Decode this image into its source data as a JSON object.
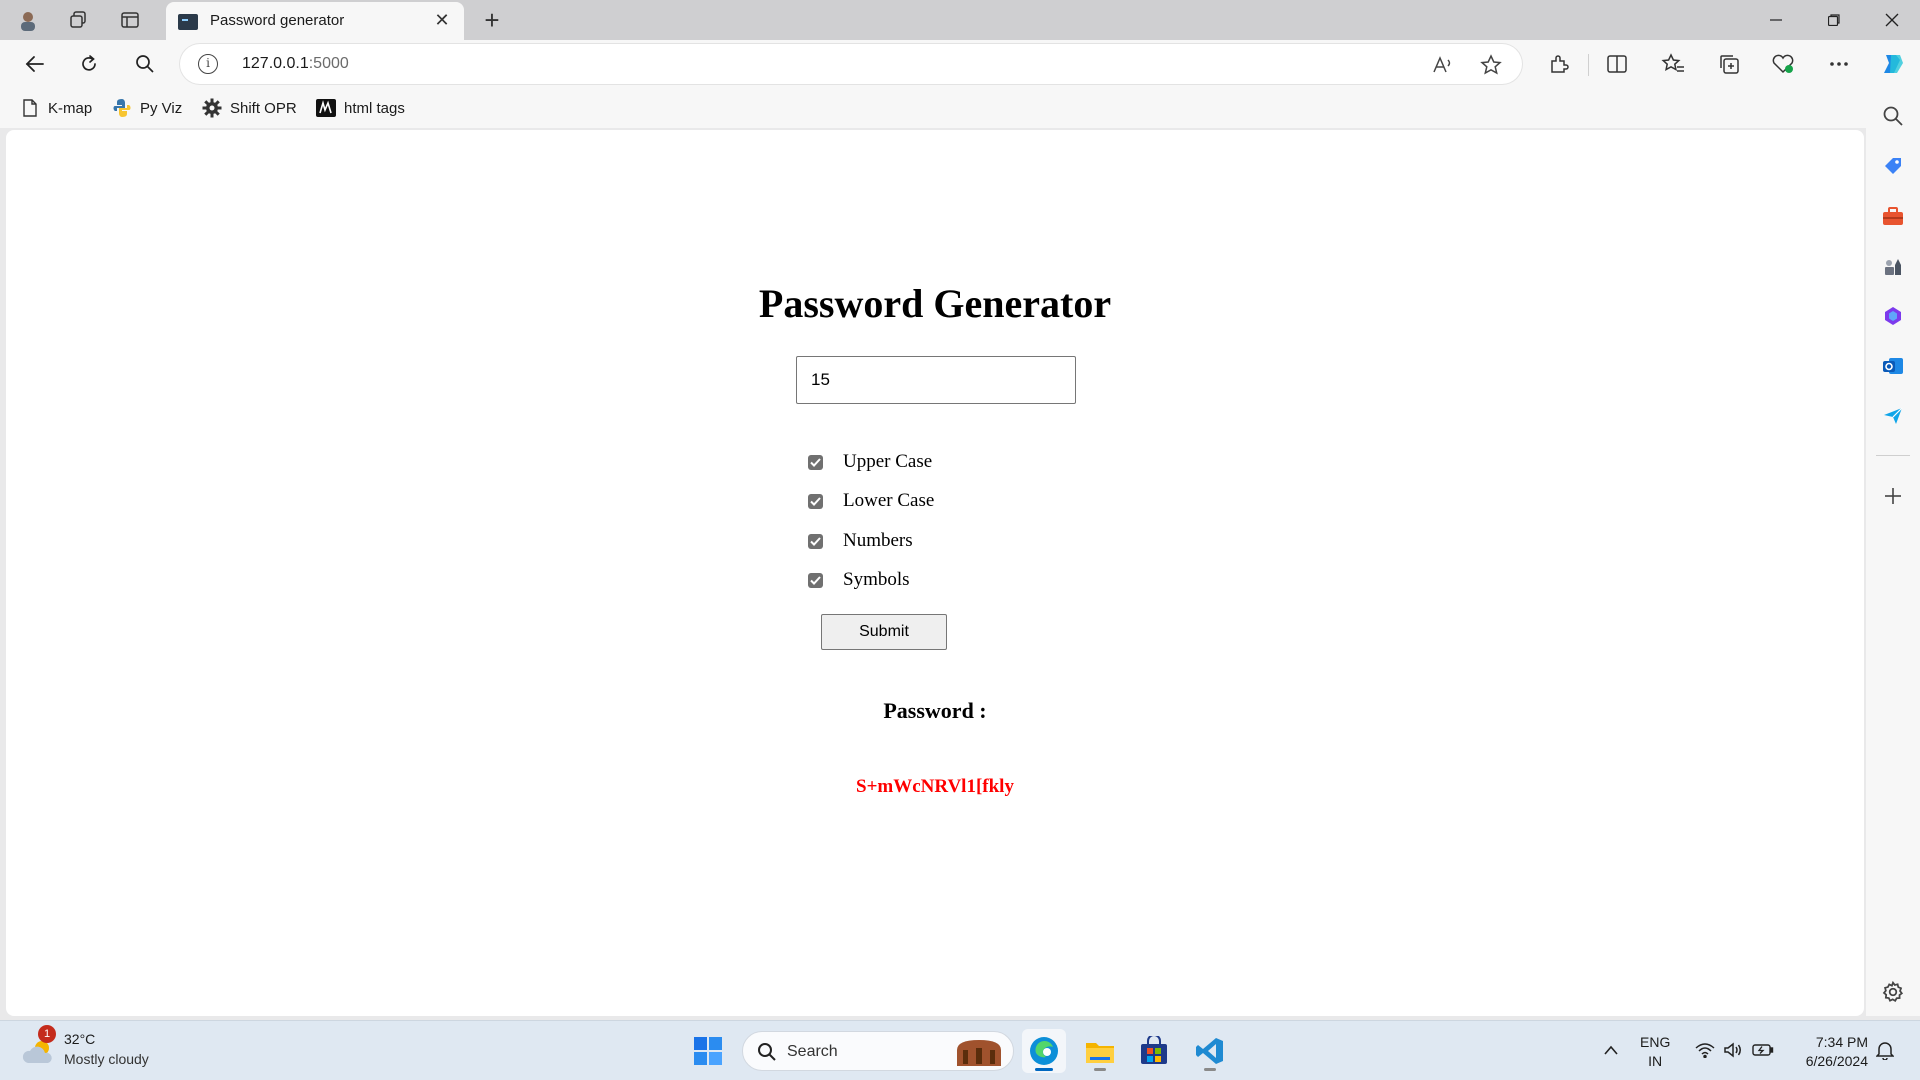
{
  "browser": {
    "tab_title": "Password generator",
    "address_host": "127.0.0.1",
    "address_port": ":5000"
  },
  "favorites": [
    {
      "label": "K-map",
      "icon": "document-icon"
    },
    {
      "label": "Py Viz",
      "icon": "python-icon"
    },
    {
      "label": "Shift OPR",
      "icon": "gear-icon"
    },
    {
      "label": "html tags",
      "icon": "m-logo-icon"
    }
  ],
  "page": {
    "title": "Password Generator",
    "length_value": "15",
    "options": [
      {
        "label": "Upper Case",
        "checked": true
      },
      {
        "label": "Lower Case",
        "checked": true
      },
      {
        "label": "Numbers",
        "checked": true
      },
      {
        "label": "Symbols",
        "checked": true
      }
    ],
    "submit_label": "Submit",
    "result_label": "Password :",
    "result_value": "S+mWcNRVl1[fkly",
    "result_color": "#ff0000"
  },
  "taskbar": {
    "weather_badge": "1",
    "weather_temp": "32°C",
    "weather_desc": "Mostly cloudy",
    "search_label": "Search",
    "lang_line1": "ENG",
    "lang_line2": "IN",
    "time": "7:34 PM",
    "date": "6/26/2024"
  }
}
